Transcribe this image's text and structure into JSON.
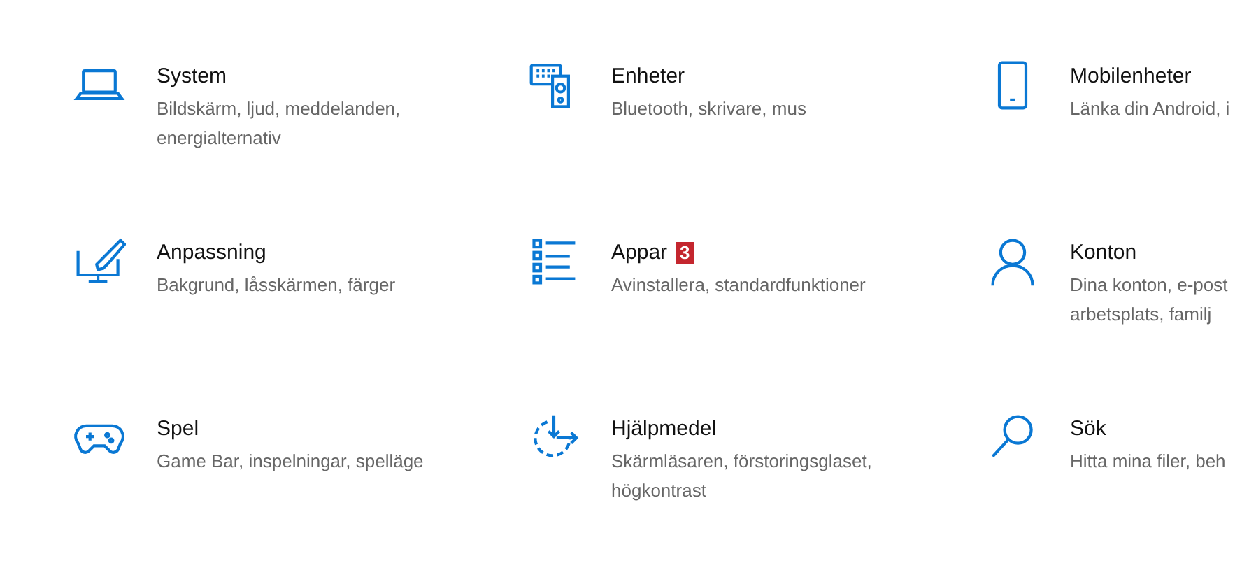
{
  "settings": [
    {
      "title": "System",
      "description": "Bildskärm, ljud, meddelanden, energialternativ"
    },
    {
      "title": "Enheter",
      "description": "Bluetooth, skrivare, mus"
    },
    {
      "title": "Mobilenheter",
      "description": "Länka din Android, i"
    },
    {
      "title": "Anpassning",
      "description": "Bakgrund, låsskärmen, färger"
    },
    {
      "title": "Appar",
      "badge": "3",
      "description": "Avinstallera, standardfunktioner"
    },
    {
      "title": "Konton",
      "description": "Dina konton, e-post arbetsplats, familj"
    },
    {
      "title": "Spel",
      "description": "Game Bar, inspelningar, spelläge"
    },
    {
      "title": "Hjälpmedel",
      "description": "Skärmläsaren, förstoringsglaset, högkontrast"
    },
    {
      "title": "Sök",
      "description": "Hitta mina filer, beh"
    }
  ]
}
